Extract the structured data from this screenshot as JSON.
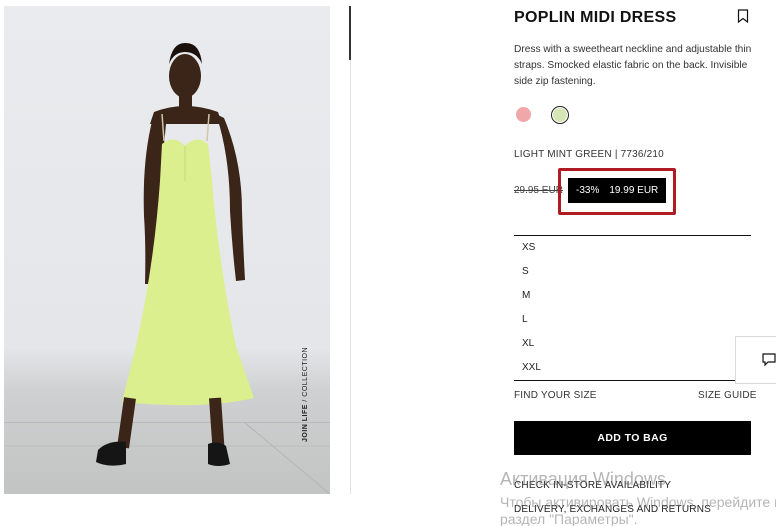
{
  "product": {
    "title": "POPLIN MIDI DRESS",
    "description": "Dress with a sweetheart neckline and adjustable thin straps. Smocked elastic fabric on the back. Invisible side zip fastening.",
    "colors": [
      {
        "name": "pink",
        "hex": "#f0a7a9",
        "selected": false
      },
      {
        "name": "light mint green",
        "hex": "#d7e6b7",
        "selected": true
      }
    ],
    "color_code": "LIGHT MINT GREEN | 7736/210",
    "image_caption_bold": "JOIN LIFE",
    "image_caption_rest": " / COLLECTION"
  },
  "price": {
    "old": "29.95 EUR",
    "discount": "-33%",
    "current": "19.99 EUR"
  },
  "sizes": [
    "XS",
    "S",
    "M",
    "L",
    "XL",
    "XXL"
  ],
  "links": {
    "find_size": "FIND YOUR SIZE",
    "size_guide": "SIZE GUIDE",
    "add_to_bag": "ADD TO BAG",
    "check_store": "CHECK IN-STORE AVAILABILITY",
    "delivery": "DELIVERY, EXCHANGES AND RETURNS"
  },
  "watermark": {
    "line1": "Активация Windows",
    "line2": "Чтобы активировать Windows, перейдите в",
    "line3": "раздел \"Параметры\"."
  },
  "colors_ui": {
    "accent": "#000000",
    "highlight": "#b01c24",
    "dress": "#dcef8e"
  }
}
